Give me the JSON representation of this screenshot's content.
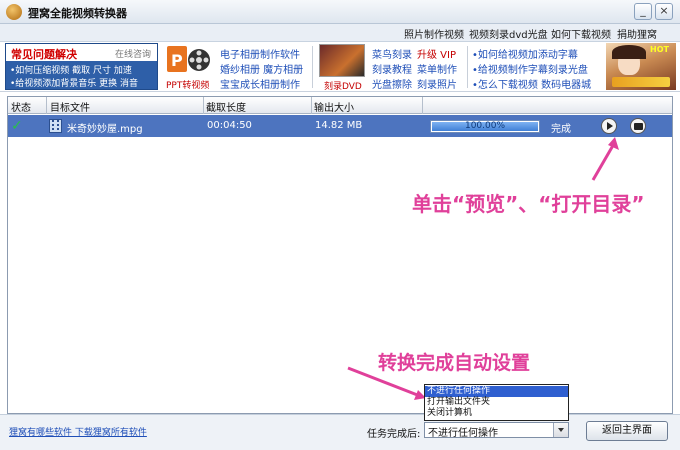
{
  "window": {
    "title": "狸窝全能视频转换器",
    "minimize_label": "_",
    "close_label": "×"
  },
  "top_menu": [
    "照片制作视频",
    "视频刻录dvd光盘",
    "如何下载视频",
    "捐助狸窝"
  ],
  "banner": {
    "faq_title": "常见问题解决",
    "faq_online": "在线咨询",
    "faq_lines": [
      "•如何压缩视频  截取  尺寸  加速",
      "•给视频添加背景音乐  更换  消音"
    ],
    "ppt_label": "PPT转视频",
    "album_links": [
      "电子相册制作软件",
      "婚纱相册  魔方相册",
      "宝宝成长相册制作"
    ],
    "dvd_label": "刻录DVD",
    "burn_links_col1": [
      "菜鸟刻录",
      "刻录教程",
      "光盘擦除"
    ],
    "burn_links_col2": [
      "升级 VIP",
      "菜单制作",
      "刻录照片"
    ],
    "tips": [
      "•如何给视频加添动字幕",
      "•给视频制作字幕刻录光盘",
      "•怎么下载视频   数码电器城"
    ],
    "game_text": "HOT"
  },
  "table": {
    "columns": [
      "状态",
      "目标文件",
      "截取长度",
      "输出大小"
    ],
    "rows": [
      {
        "status": "✓",
        "file": "米奇妙妙屋.mpg",
        "duration": "00:04:50",
        "size": "14.82 MB",
        "progress_text": "100.00%",
        "progress": 1.0,
        "state": "完成"
      }
    ]
  },
  "annotations": {
    "preview_hint": "单击“预览”、“打开目录”",
    "auto_setting_hint": "转换完成自动设置"
  },
  "bottom": {
    "link": "狸窝有哪些软件 下载狸窝所有软件",
    "after_label": "任务完成后:",
    "select_value": "不进行任何操作",
    "options": [
      "不进行任何操作",
      "打开输出文件夹",
      "关闭计算机"
    ],
    "back_button": "返回主界面"
  },
  "colors": {
    "selected_row": "#4d74bf",
    "annotation": "#e0409a",
    "faq_panel": "#2e5fa8"
  }
}
